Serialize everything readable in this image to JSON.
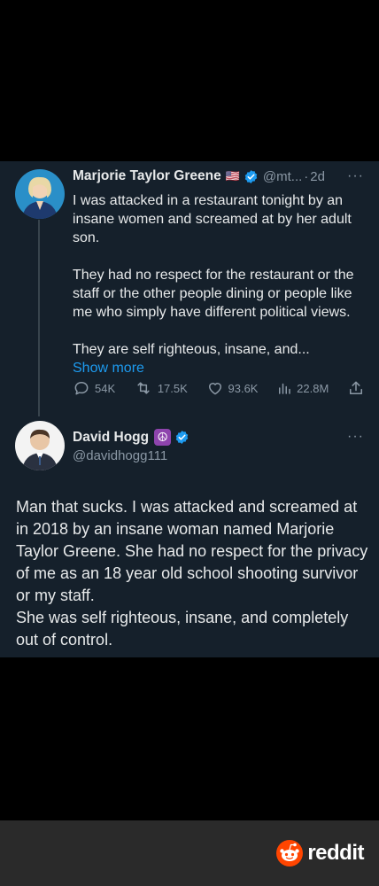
{
  "tweet1": {
    "author_name": "Marjorie Taylor Greene",
    "flag": "🇺🇸",
    "handle": "@mt...",
    "separator": "·",
    "time": "2d",
    "more": "···",
    "paragraphs": [
      "I was attacked in a restaurant tonight by an insane women and screamed at by her adult son.",
      "They had no respect for the restaurant or the staff or the other people dining or people like me who simply have different political views.",
      "They are self righteous, insane, and..."
    ],
    "show_more": "Show more",
    "stats": {
      "replies": "54K",
      "retweets": "17.5K",
      "likes": "93.6K",
      "views": "22.8M"
    }
  },
  "tweet2": {
    "author_name": "David Hogg",
    "emoji": "☮",
    "handle": "@davidhogg111",
    "more": "···",
    "lines": [
      "Man that sucks. I was attacked and screamed at in 2018 by an insane woman named Marjorie Taylor Greene. She had no respect for the privacy of me as an 18 year old school shooting survivor or my staff.",
      "She was self righteous, insane, and completely out of control."
    ]
  },
  "footer": {
    "brand": "reddit"
  },
  "colors": {
    "background": "#000000",
    "panel": "#15202b",
    "text": "#e7e9ea",
    "secondary": "#8b98a5",
    "link": "#1d9bf0",
    "verified": "#1d9bf0",
    "reddit_orange": "#ff4500",
    "footer": "#2a2a2a"
  }
}
